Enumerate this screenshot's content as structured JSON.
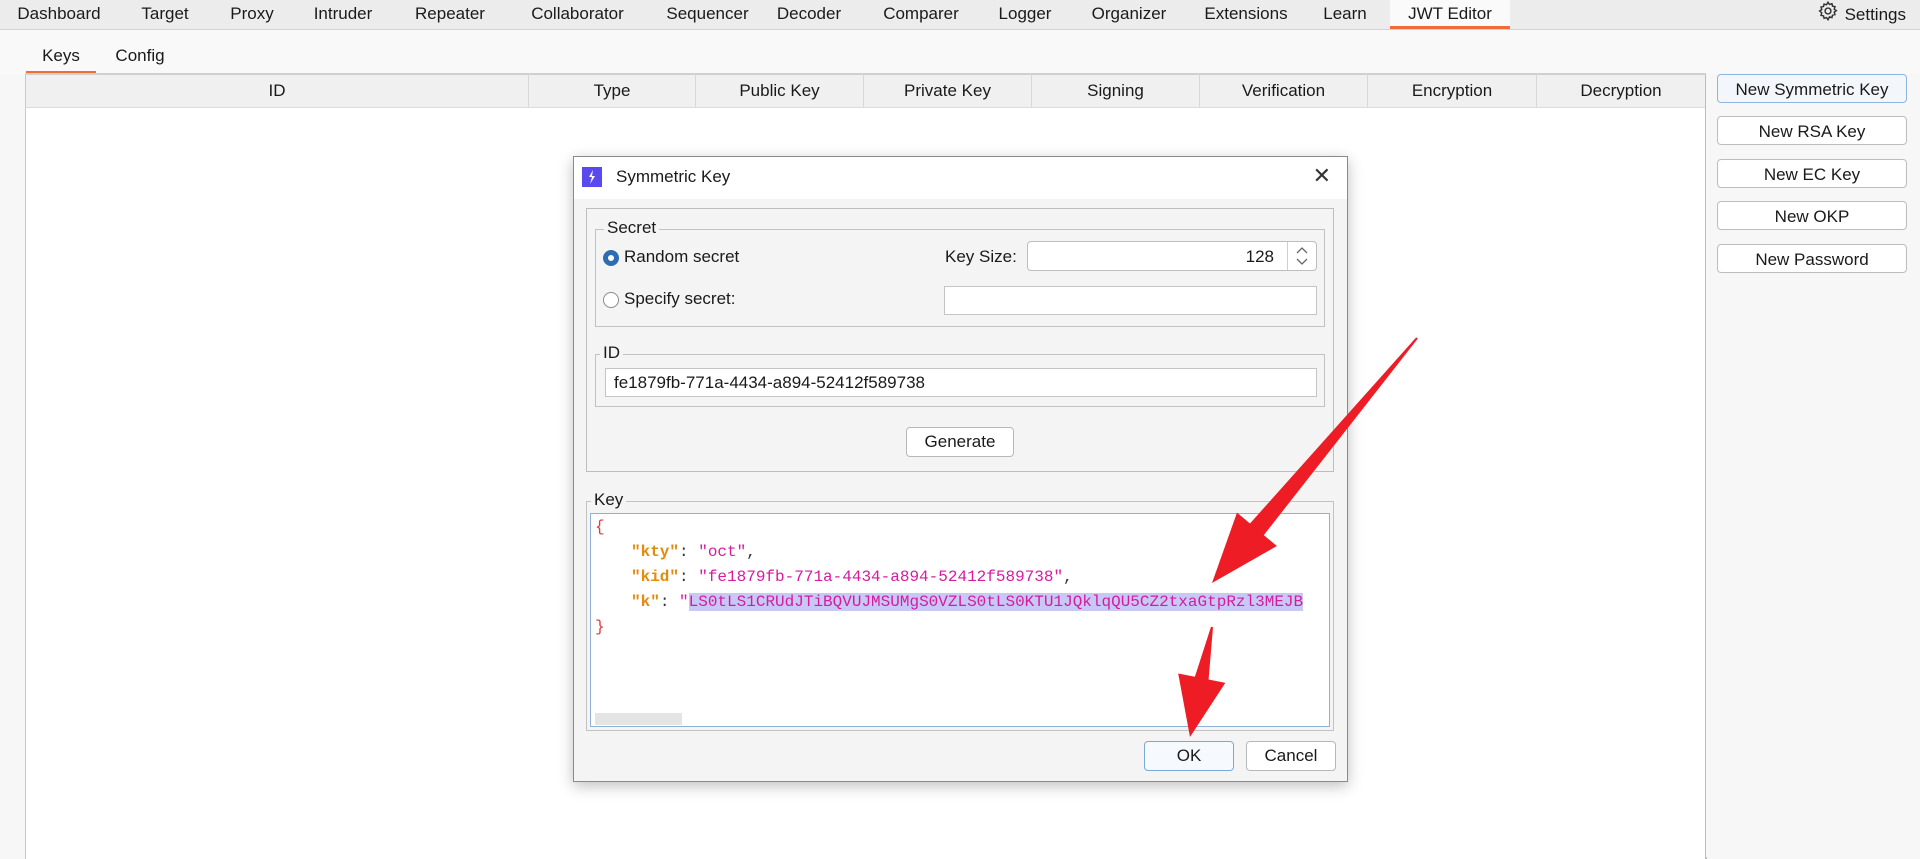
{
  "top_tabs": [
    {
      "label": "Dashboard",
      "active": false
    },
    {
      "label": "Target",
      "active": false
    },
    {
      "label": "Proxy",
      "active": false
    },
    {
      "label": "Intruder",
      "active": false
    },
    {
      "label": "Repeater",
      "active": false
    },
    {
      "label": "Collaborator",
      "active": false
    },
    {
      "label": "Sequencer",
      "active": false
    },
    {
      "label": "Decoder",
      "active": false
    },
    {
      "label": "Comparer",
      "active": false
    },
    {
      "label": "Logger",
      "active": false
    },
    {
      "label": "Organizer",
      "active": false
    },
    {
      "label": "Extensions",
      "active": false
    },
    {
      "label": "Learn",
      "active": false
    },
    {
      "label": "JWT Editor",
      "active": true
    }
  ],
  "settings": {
    "label": "Settings",
    "icon": "gear-icon"
  },
  "sub_tabs": [
    {
      "label": "Keys",
      "active": true
    },
    {
      "label": "Config",
      "active": false
    }
  ],
  "keys_table": {
    "columns": [
      "ID",
      "Type",
      "Public Key",
      "Private Key",
      "Signing",
      "Verification",
      "Encryption",
      "Decryption"
    ],
    "rows": []
  },
  "side_buttons": [
    "New Symmetric Key",
    "New RSA Key",
    "New EC Key",
    "New OKP",
    "New Password"
  ],
  "dialog": {
    "title": "Symmetric Key",
    "icon": "lightning-icon",
    "secret_group": {
      "legend": "Secret",
      "random_label": "Random secret",
      "random_selected": true,
      "specify_label": "Specify secret:",
      "specify_selected": false,
      "specify_value": "",
      "key_size_label": "Key Size:",
      "key_size_value": "128"
    },
    "id_group": {
      "legend": "ID",
      "value": "fe1879fb-771a-4434-a894-52412f589738"
    },
    "generate_label": "Generate",
    "key_group": {
      "legend": "Key",
      "json": {
        "open": "{",
        "close": "}",
        "kty_key": "\"kty\"",
        "kty_val": "\"oct\"",
        "kid_key": "\"kid\"",
        "kid_val": "\"fe1879fb-771a-4434-a894-52412f589738\"",
        "k_key": "\"k\"",
        "k_quote": "\"",
        "k_val": "LS0tLS1CRUdJTiBQVUJMSUMgS0VZLS0tLS0KTU1JQklqQU5CZ2txaGtpRzl3MEJB"
      }
    },
    "ok_label": "OK",
    "cancel_label": "Cancel"
  },
  "annotations": {
    "arrow_color": "#ee1c25"
  }
}
